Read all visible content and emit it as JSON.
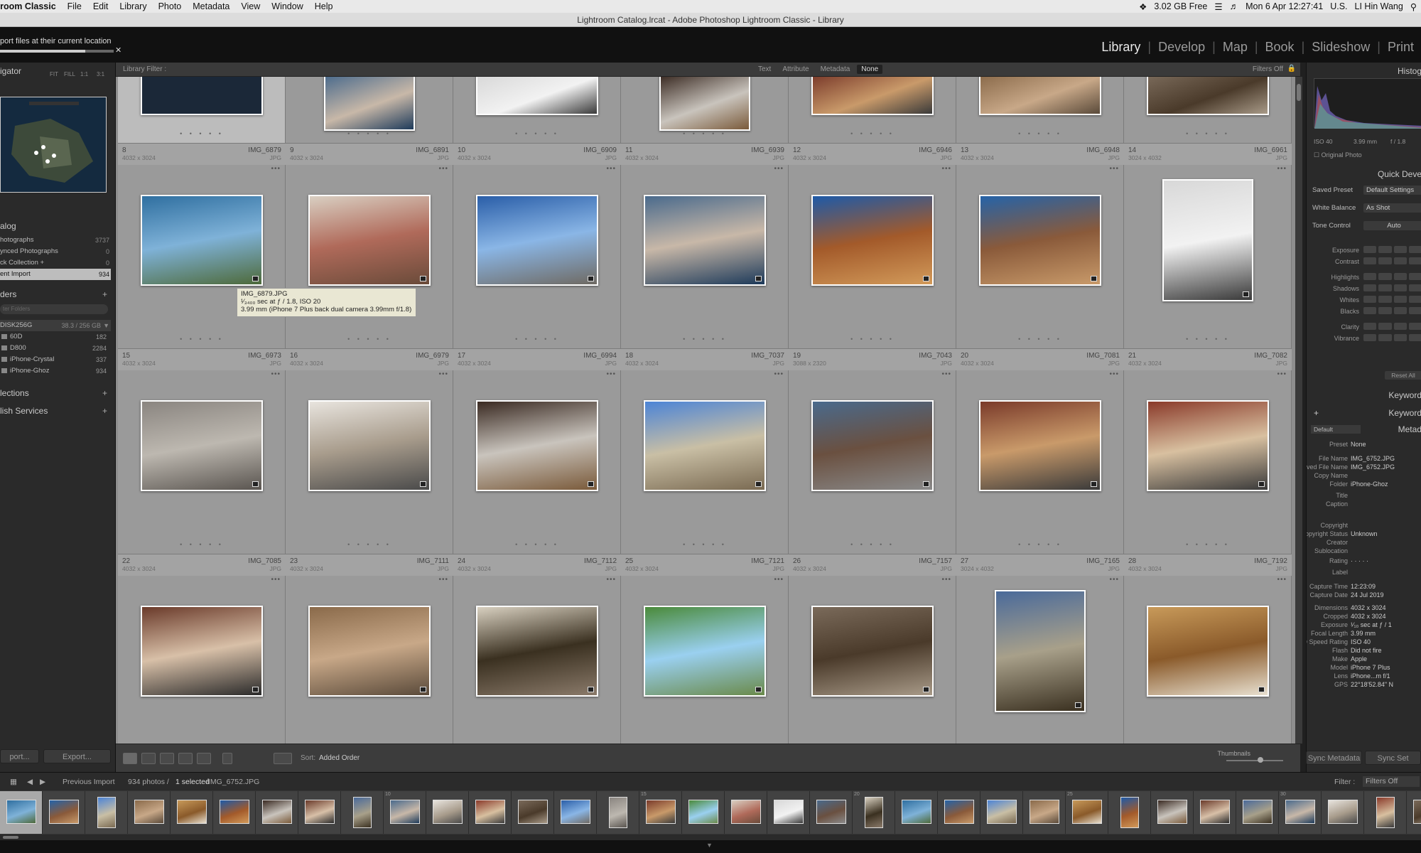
{
  "mac_menubar": {
    "app_name": "troom Classic",
    "menus": [
      "File",
      "Edit",
      "Library",
      "Photo",
      "Metadata",
      "View",
      "Window",
      "Help"
    ],
    "disk_free": "3.02 GB Free",
    "datetime": "Mon 6 Apr 12:27:41",
    "input_source": "U.S.",
    "user_name": "LI Hin Wang"
  },
  "window_title": "Lightroom Catalog.lrcat - Adobe Photoshop Lightroom Classic - Library",
  "activity": {
    "message": "port files at their current location",
    "progress": 0.75
  },
  "modules": [
    "Library",
    "Develop",
    "Map",
    "Book",
    "Slideshow",
    "Print"
  ],
  "active_module": "Library",
  "left_panel": {
    "navigator_title": "igator",
    "zoom_options": [
      "FIT",
      "FILL",
      "1:1",
      "3:1"
    ],
    "catalog_title": "alog",
    "catalog_items": [
      {
        "label": "hotographs",
        "count": "3737"
      },
      {
        "label": "ynced Photographs",
        "count": "0"
      },
      {
        "label": "ck Collection +",
        "count": "0"
      },
      {
        "label": "ent Import",
        "count": "934"
      }
    ],
    "folders_title": "ders",
    "folder_filter_placeholder": "ter Folders",
    "volume": {
      "name": "DISK256G",
      "space": "38.3 / 256 GB"
    },
    "folders": [
      {
        "label": "60D",
        "count": "182"
      },
      {
        "label": "D800",
        "count": "2284"
      },
      {
        "label": "iPhone-Crystal",
        "count": "337"
      },
      {
        "label": "iPhone-Ghoz",
        "count": "934"
      }
    ],
    "collections_title": "lections",
    "publish_title": "lish Services",
    "import_button": "port...",
    "export_button": "Export..."
  },
  "filter_bar": {
    "label": "Library Filter :",
    "options": [
      "Text",
      "Attribute",
      "Metadata",
      "None"
    ],
    "active": "None",
    "filters_off": "Filters Off"
  },
  "grid": {
    "top_row": [
      {},
      {},
      {},
      {},
      {},
      {},
      {}
    ],
    "rows": [
      [
        {
          "idx": "8",
          "name": "IMG_6879",
          "dims": "4032 x 3024",
          "ext": "JPG"
        },
        {
          "idx": "9",
          "name": "IMG_6891",
          "dims": "4032 x 3024",
          "ext": "JPG"
        },
        {
          "idx": "10",
          "name": "IMG_6909",
          "dims": "4032 x 3024",
          "ext": "JPG"
        },
        {
          "idx": "11",
          "name": "IMG_6939",
          "dims": "4032 x 3024",
          "ext": "JPG"
        },
        {
          "idx": "12",
          "name": "IMG_6946",
          "dims": "4032 x 3024",
          "ext": "JPG"
        },
        {
          "idx": "13",
          "name": "IMG_6948",
          "dims": "4032 x 3024",
          "ext": "JPG"
        },
        {
          "idx": "14",
          "name": "IMG_6961",
          "dims": "3024 x 4032",
          "ext": "JPG"
        }
      ],
      [
        {
          "idx": "15",
          "name": "IMG_6973",
          "dims": "4032 x 3024",
          "ext": "JPG"
        },
        {
          "idx": "16",
          "name": "IMG_6979",
          "dims": "4032 x 3024",
          "ext": "JPG"
        },
        {
          "idx": "17",
          "name": "IMG_6994",
          "dims": "4032 x 3024",
          "ext": "JPG"
        },
        {
          "idx": "18",
          "name": "IMG_7037",
          "dims": "4032 x 3024",
          "ext": "JPG"
        },
        {
          "idx": "19",
          "name": "IMG_7043",
          "dims": "3088 x 2320",
          "ext": "JPG"
        },
        {
          "idx": "20",
          "name": "IMG_7081",
          "dims": "4032 x 3024",
          "ext": "JPG"
        },
        {
          "idx": "21",
          "name": "IMG_7082",
          "dims": "4032 x 3024",
          "ext": "JPG"
        }
      ],
      [
        {
          "idx": "22",
          "name": "IMG_7085",
          "dims": "4032 x 3024",
          "ext": "JPG"
        },
        {
          "idx": "23",
          "name": "IMG_7111",
          "dims": "4032 x 3024",
          "ext": "JPG"
        },
        {
          "idx": "24",
          "name": "IMG_7112",
          "dims": "4032 x 3024",
          "ext": "JPG"
        },
        {
          "idx": "25",
          "name": "IMG_7121",
          "dims": "4032 x 3024",
          "ext": "JPG"
        },
        {
          "idx": "26",
          "name": "IMG_7157",
          "dims": "4032 x 3024",
          "ext": "JPG"
        },
        {
          "idx": "27",
          "name": "IMG_7165",
          "dims": "3024 x 4032",
          "ext": "JPG"
        },
        {
          "idx": "28",
          "name": "IMG_7192",
          "dims": "4032 x 3024",
          "ext": "JPG"
        }
      ]
    ],
    "tooltip": {
      "line1": "IMG_6879.JPG",
      "line2": "¹⁄₃₄₀₀ sec at ƒ / 1.8, ISO 20",
      "line3": "3.99 mm (iPhone 7 Plus back dual camera 3.99mm f/1.8)"
    }
  },
  "toolbar": {
    "sort_label": "Sort:",
    "sort_value": "Added Order",
    "thumbnails_label": "Thumbnails"
  },
  "right_panel": {
    "histogram_title": "Histog",
    "histogram_info": {
      "iso": "ISO 40",
      "focal": "3.99 mm",
      "aperture": "f / 1.8"
    },
    "original_photo": "Original Photo",
    "quick_develop_title": "Quick Deve",
    "saved_preset": {
      "label": "Saved Preset",
      "value": "Default Settings"
    },
    "white_balance": {
      "label": "White Balance",
      "value": "As Shot"
    },
    "tone_control": {
      "label": "Tone Control",
      "value": "Auto"
    },
    "adjustments": [
      "Exposure",
      "Contrast",
      "Highlights",
      "Shadows",
      "Whites",
      "Blacks",
      "Clarity",
      "Vibrance"
    ],
    "reset_all": "Reset All",
    "keywording_title": "Keyword",
    "keyword_list_title": "Keyword",
    "metadata_title": "Metad",
    "metadata_preset_select": "Default",
    "metadata_rows": [
      {
        "label": "Preset",
        "value": "None"
      },
      {
        "label": "File Name",
        "value": "IMG_6752.JPG"
      },
      {
        "label": "Preserved File Name",
        "value": "IMG_6752.JPG"
      },
      {
        "label": "Copy Name",
        "value": ""
      },
      {
        "label": "Folder",
        "value": "iPhone-Ghoz"
      },
      {
        "label": "Title",
        "value": ""
      },
      {
        "label": "Caption",
        "value": ""
      },
      {
        "label": "Copyright",
        "value": ""
      },
      {
        "label": "Copyright Status",
        "value": "Unknown"
      },
      {
        "label": "Creator",
        "value": ""
      },
      {
        "label": "Sublocation",
        "value": ""
      },
      {
        "label": "Rating",
        "value": "· · · · ·"
      },
      {
        "label": "Label",
        "value": ""
      },
      {
        "label": "Capture Time",
        "value": "12:23:09"
      },
      {
        "label": "Capture Date",
        "value": "24 Jul 2019"
      },
      {
        "label": "Dimensions",
        "value": "4032 x 3024"
      },
      {
        "label": "Cropped",
        "value": "4032 x 3024"
      },
      {
        "label": "Exposure",
        "value": "¹⁄₁₀ sec at ƒ / 1"
      },
      {
        "label": "Focal Length",
        "value": "3.99 mm"
      },
      {
        "label": "ISO Speed Rating",
        "value": "ISO 40"
      },
      {
        "label": "Flash",
        "value": "Did not fire"
      },
      {
        "label": "Make",
        "value": "Apple"
      },
      {
        "label": "Model",
        "value": "iPhone 7 Plus"
      },
      {
        "label": "Lens",
        "value": "iPhone...m f/1"
      },
      {
        "label": "GPS",
        "value": "22°18'52.84\" N"
      }
    ],
    "sync_metadata": "Sync Metadata",
    "sync_settings": "Sync Set"
  },
  "filmstrip": {
    "source": "Previous Import",
    "count_text": "934 photos /",
    "selected_text": "1 selected",
    "current_file": "/IMG_6752.JPG",
    "filter_label": "Filter :",
    "filter_value": "Filters Off",
    "numbers": [
      "",
      "",
      "",
      "",
      "",
      "",
      "",
      "",
      "",
      "10",
      "",
      "",
      "",
      "",
      "",
      "15",
      "",
      "",
      "",
      "",
      "20",
      "",
      "",
      "",
      "",
      "25",
      "",
      "",
      "",
      "",
      "30",
      "",
      "",
      "",
      ""
    ]
  },
  "colors": {
    "accent": "#e8e8e8",
    "grid_bg": "#8e8e8e",
    "panel_bg": "#2a2a2a"
  }
}
